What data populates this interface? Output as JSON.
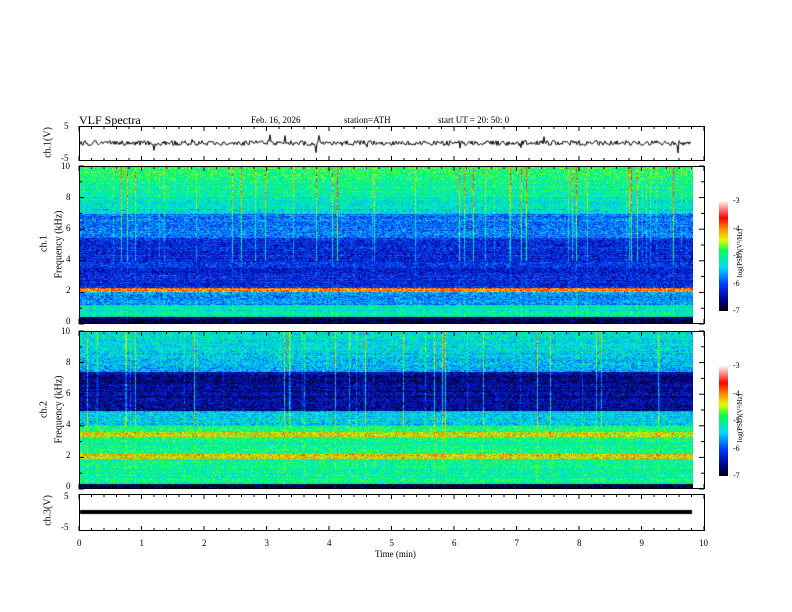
{
  "header": {
    "title": "VLF  Spectra",
    "date": "Feb. 16, 2026",
    "station": "station=ATH",
    "start": "start  UT  =    20: 50: 0"
  },
  "chart_data": [
    {
      "type": "line",
      "ylabel": "ch.1(V)",
      "ylim": [
        -5,
        5
      ],
      "yticks": [
        "5",
        "-5"
      ],
      "description_values": "noisy trace near 0 V"
    },
    {
      "type": "heatmap",
      "ylabel": "ch.1\nFrequency (kHz)",
      "ylabel_top": "ch.1",
      "ylabel_main": "Frequency (kHz)",
      "ylim": [
        0,
        10
      ],
      "yticks": [
        "0",
        "2",
        "4",
        "6",
        "8",
        "10"
      ],
      "colorbar": {
        "label": "log(PSD)(V²/Hz)",
        "range": [
          -7,
          -3
        ],
        "ticks": [
          "-3",
          "-4",
          "-5",
          "-6",
          "-7"
        ]
      }
    },
    {
      "type": "heatmap",
      "ylabel_top": "ch.2",
      "ylabel_main": "Frequency (kHz)",
      "ylim": [
        0,
        10
      ],
      "yticks": [
        "0",
        "2",
        "4",
        "6",
        "8",
        "10"
      ],
      "colorbar": {
        "label": "log(PSD)(V²/Hz)",
        "range": [
          -7,
          -3
        ],
        "ticks": [
          "-3",
          "-4",
          "-5",
          "-6",
          "-7"
        ]
      }
    },
    {
      "type": "line",
      "ylabel": "ch.3(V)",
      "ylim": [
        -5,
        5
      ],
      "yticks": [
        "5",
        "-5"
      ]
    },
    {
      "xlabel": "Time (min)",
      "xlim": [
        0,
        10
      ],
      "xticks": [
        "0",
        "1",
        "2",
        "3",
        "4",
        "5",
        "6",
        "7",
        "8",
        "9",
        "10"
      ]
    }
  ]
}
